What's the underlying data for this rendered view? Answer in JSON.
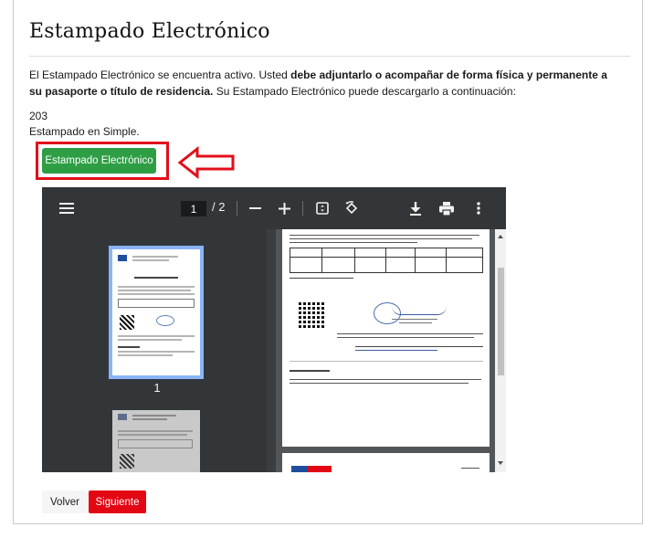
{
  "page": {
    "title": "Estampado Electrónico",
    "notice": {
      "text_1": "El Estampado Electrónico se encuentra activo. Usted ",
      "bold_1": "debe adjuntarlo o acompañar de forma física y permanente a su pasaporte o título de residencia.",
      "text_2": " Su Estampado Electrónico puede descargarlo a continuación:"
    },
    "number": "203",
    "status": "Estampado en Simple.",
    "download_button_label": "Estampado Electrónico"
  },
  "viewer": {
    "current_page": "1",
    "total_pages": "/ 2",
    "thumbnail_1_label": "1",
    "icons": {
      "menu": "hamburger-menu-icon",
      "zoom_out": "minus-icon",
      "zoom_in": "plus-icon",
      "fit": "fit-to-page-icon",
      "rotate": "rotate-icon",
      "download": "download-icon",
      "print": "print-icon",
      "more": "more-vertical-icon"
    }
  },
  "footer": {
    "back_label": "Volver",
    "next_label": "Siguiente"
  },
  "colors": {
    "primary_green": "#2e9e45",
    "highlight_red": "#e10f1a",
    "next_red": "#e30613",
    "viewer_toolbar": "#323639",
    "viewer_bg": "#525659",
    "thumb_selected": "#8ab4f8"
  }
}
